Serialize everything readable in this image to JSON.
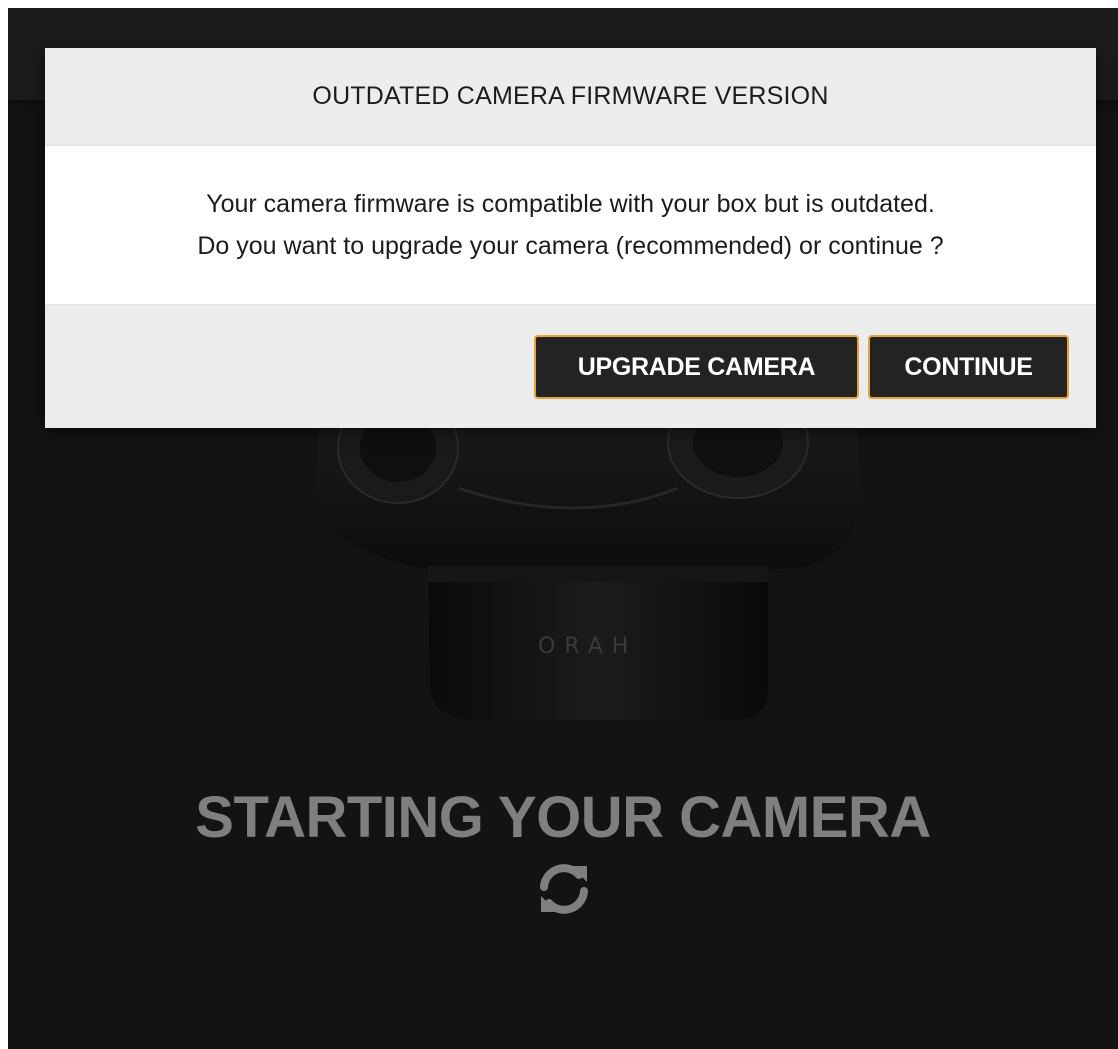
{
  "dialog": {
    "title": "OUTDATED CAMERA FIRMWARE VERSION",
    "message_line1": "Your camera firmware is compatible with your box but is outdated.",
    "message_line2": "Do you want to upgrade your camera (recommended) or continue ?",
    "upgrade_button_label": "UPGRADE CAMERA",
    "continue_button_label": "CONTINUE"
  },
  "status": {
    "title": "STARTING YOUR CAMERA",
    "icon": "refresh-icon"
  },
  "camera": {
    "brand_text": "ORAH",
    "image": "camera-image"
  },
  "colors": {
    "background": "#131313",
    "button_background": "#232323",
    "button_border_accent": "#e8a23a",
    "status_text": "#7f7f7f",
    "dialog_header_footer": "#ececec"
  }
}
